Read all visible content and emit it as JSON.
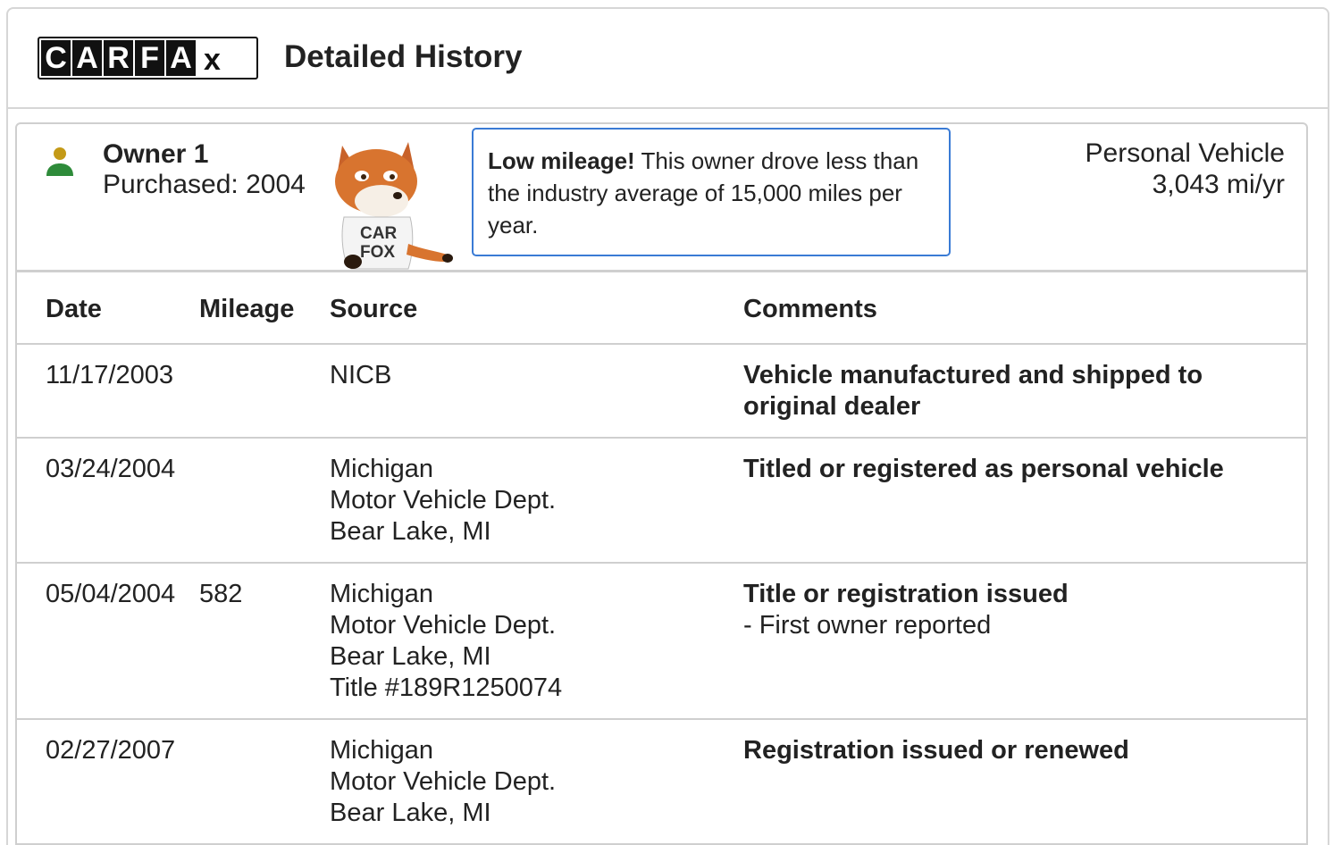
{
  "header": {
    "logo_letters": [
      "C",
      "A",
      "R",
      "F",
      "A",
      "x"
    ],
    "title": "Detailed History"
  },
  "owner": {
    "name": "Owner 1",
    "purchased": "Purchased: 2004",
    "tip_bold": "Low mileage!",
    "tip_text": " This owner drove less than the industry average of 15,000 miles per year.",
    "mascot_shirt": [
      "CAR",
      "FOX"
    ],
    "vehicle_type": "Personal Vehicle",
    "mileage_per_year": "3,043 mi/yr",
    "icon_head_color": "#c49a17",
    "icon_body_color": "#2e8b3a"
  },
  "table": {
    "columns": [
      "Date",
      "Mileage",
      "Source",
      "Comments"
    ],
    "rows": [
      {
        "date": "11/17/2003",
        "mileage": "",
        "source": [
          "NICB"
        ],
        "comment": "Vehicle manufactured and shipped to original dealer",
        "sub": ""
      },
      {
        "date": "03/24/2004",
        "mileage": "",
        "source": [
          "Michigan",
          "Motor Vehicle Dept.",
          "Bear Lake, MI"
        ],
        "comment": "Titled or registered as personal vehicle",
        "sub": ""
      },
      {
        "date": "05/04/2004",
        "mileage": "582",
        "source": [
          "Michigan",
          "Motor Vehicle Dept.",
          "Bear Lake, MI",
          "Title #189R1250074"
        ],
        "comment": "Title or registration issued",
        "sub": "- First owner reported"
      },
      {
        "date": "02/27/2007",
        "mileage": "",
        "source": [
          "Michigan",
          "Motor Vehicle Dept.",
          "Bear Lake, MI"
        ],
        "comment": "Registration issued or renewed",
        "sub": ""
      }
    ]
  }
}
